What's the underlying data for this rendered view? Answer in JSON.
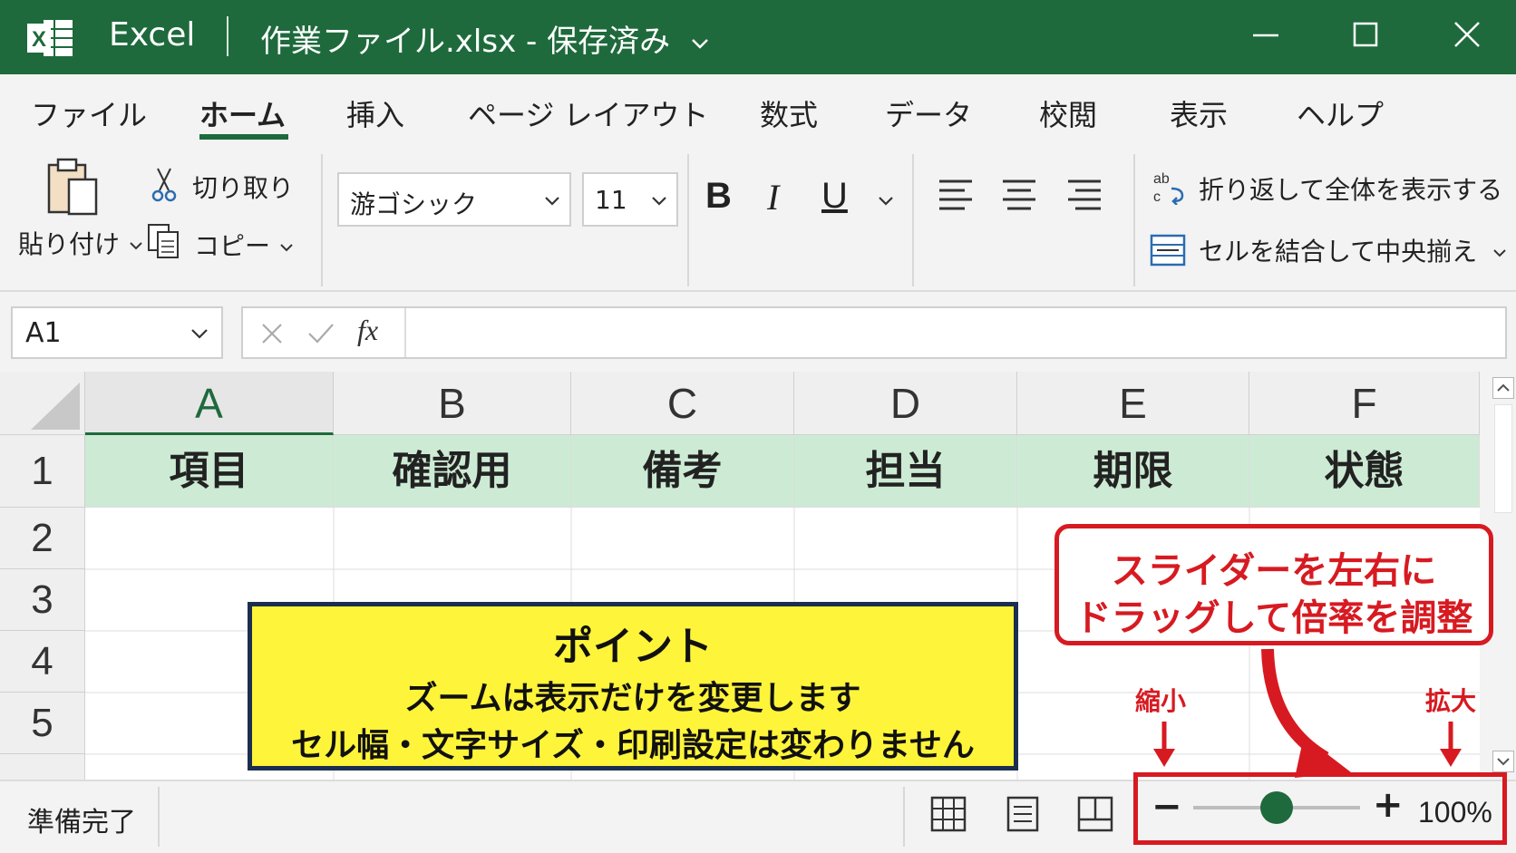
{
  "titlebar": {
    "logo_letter": "X",
    "app_name": "Excel",
    "document_title": "作業ファイル.xlsx - 保存済み",
    "bg_color": "#1e6a3c"
  },
  "menu": {
    "tabs": [
      "ファイル",
      "ホーム",
      "挿入",
      "ページ レイアウト",
      "数式",
      "データ",
      "校閲",
      "表示",
      "ヘルプ"
    ],
    "active": "ホーム"
  },
  "ribbon": {
    "paste_label": "貼り付け",
    "cut_label": "切り取り",
    "copy_label": "コピー",
    "font_name": "游ゴシック",
    "font_size": "11",
    "bold": "B",
    "italic": "I",
    "underline": "U",
    "wrap_label": "折り返して全体を表示する",
    "merge_label": "セルを結合して中央揃え"
  },
  "formula_bar": {
    "name_box": "A1",
    "fx": "fx",
    "content": ""
  },
  "sheet": {
    "columns": [
      "A",
      "B",
      "C",
      "D",
      "E",
      "F"
    ],
    "selected_column": "A",
    "rows": [
      "1",
      "2",
      "3",
      "4",
      "5"
    ],
    "header_row": [
      "項目",
      "確認用",
      "備考",
      "担当",
      "期限",
      "状態"
    ],
    "header_fill": "#cdebd4"
  },
  "callout_point": {
    "title": "ポイント",
    "line1": "ズームは表示だけを変更します",
    "line2": "セル幅・文字サイズ・印刷設定は変わりません"
  },
  "callout_slider": {
    "line1": "スライダーを左右に",
    "line2": "ドラッグして倍率を調整",
    "shrink_label": "縮小",
    "enlarge_label": "拡大",
    "accent_color": "#d71a21"
  },
  "statusbar": {
    "status": "準備完了",
    "zoom_minus": "−",
    "zoom_plus": "+",
    "zoom_level": "100%",
    "zoom_fraction": 0.5
  }
}
